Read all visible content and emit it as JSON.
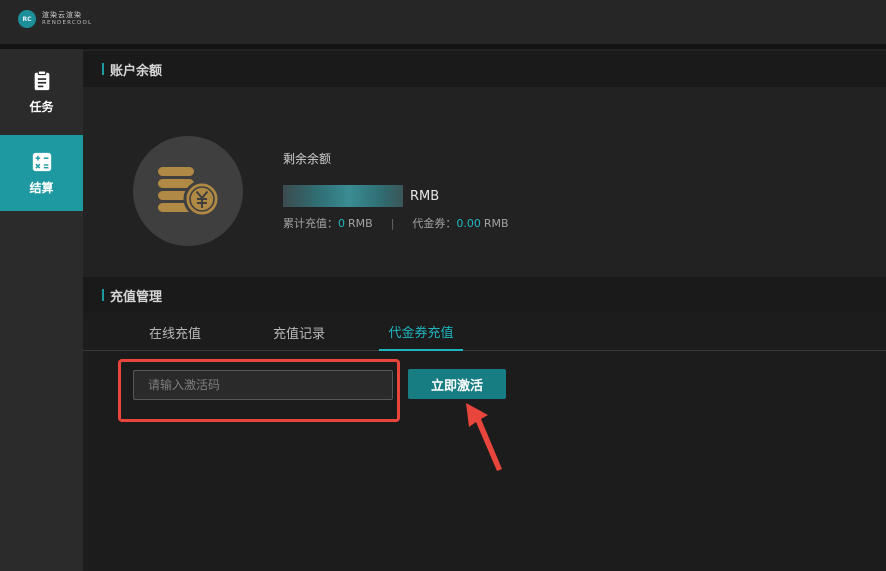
{
  "brand": {
    "mark": "RC",
    "name_cn": "渲染云渲染",
    "name_en": "RENDERCOOL",
    "accent": "#1e98a1"
  },
  "sidebar": {
    "items": [
      {
        "label": "任务",
        "icon": "clipboard-icon",
        "active": false
      },
      {
        "label": "结算",
        "icon": "calculator-icon",
        "active": true
      }
    ]
  },
  "balance": {
    "section_title": "账户余额",
    "label": "剩余余额",
    "unit": "RMB",
    "total_recharge_label": "累计充值：",
    "total_recharge_value": "0",
    "total_recharge_unit": "RMB",
    "separator": "|",
    "voucher_label": "代金券：",
    "voucher_value": "0.00",
    "voucher_unit": "RMB"
  },
  "recharge": {
    "section_title": "充值管理",
    "tabs": [
      {
        "label": "在线充值",
        "active": false
      },
      {
        "label": "充值记录",
        "active": false
      },
      {
        "label": "代金券充值",
        "active": true
      }
    ],
    "input_placeholder": "请输入激活码",
    "input_value": "",
    "activate_label": "立即激活"
  },
  "colors": {
    "accent": "#1e98a1",
    "highlight": "#e8453c",
    "coin": "#b08a45"
  }
}
